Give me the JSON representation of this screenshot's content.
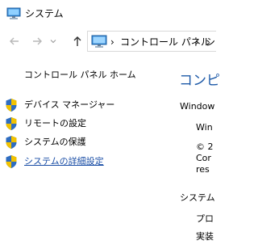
{
  "window": {
    "title": "システム"
  },
  "nav": {
    "back": "back-arrow-icon",
    "forward": "forward-arrow-icon",
    "up": "up-arrow-icon",
    "breadcrumb": [
      "コントロール パネル",
      "シ"
    ],
    "separator": "›"
  },
  "left_pane": {
    "title": "コントロール パネル ホーム",
    "tasks": [
      {
        "label": "デバイス マネージャー",
        "icon": "shield-icon"
      },
      {
        "label": "リモートの設定",
        "icon": "shield-icon"
      },
      {
        "label": "システムの保護",
        "icon": "shield-icon"
      },
      {
        "label": "システムの詳細設定",
        "icon": "shield-icon"
      }
    ]
  },
  "right_pane": {
    "heading": "コンピ",
    "edition_title": "Window",
    "edition_lines": [
      "Win",
      "© 2",
      "Cor",
      "res"
    ],
    "system_title": "システム",
    "system_lines": [
      "プロ",
      "実装"
    ]
  },
  "colors": {
    "link": "#1a4ea6",
    "heading": "#1e5aa8",
    "shield_blue": "#2f6dc0",
    "shield_yellow": "#f2c200"
  }
}
